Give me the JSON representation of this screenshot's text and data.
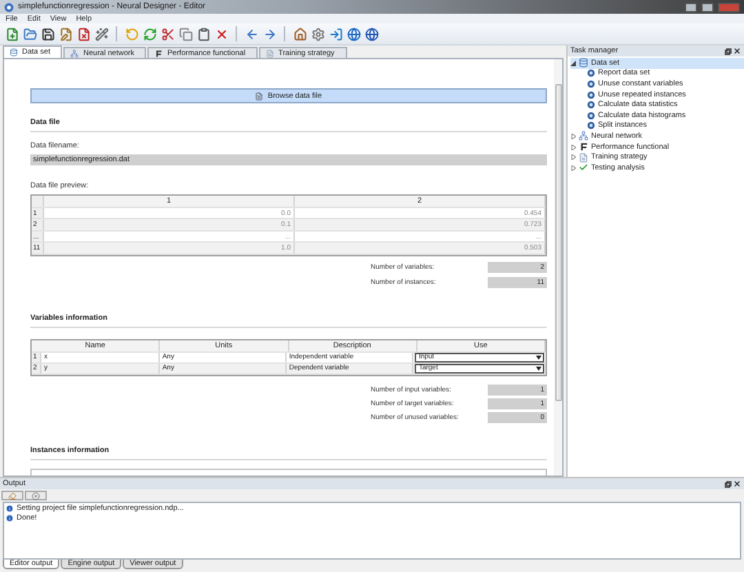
{
  "window": {
    "title": "simplefunctionregression - Neural Designer - Editor"
  },
  "menu": [
    "File",
    "Edit",
    "View",
    "Help"
  ],
  "tabs": [
    {
      "label": "Data set",
      "selected": true,
      "kind": "dataset"
    },
    {
      "label": "Neural network",
      "selected": false,
      "kind": "network"
    },
    {
      "label": "Performance functional",
      "selected": false,
      "kind": "performance"
    },
    {
      "label": "Training strategy",
      "selected": false,
      "kind": "training"
    }
  ],
  "data_set": {
    "browse_button": "Browse data file",
    "data_file": {
      "heading": "Data file",
      "filename_label": "Data filename:",
      "filename": "simplefunctionregression.dat",
      "preview_label": "Data file preview:",
      "preview": {
        "columns": [
          "1",
          "2"
        ],
        "rows": [
          {
            "index": "1",
            "cells": [
              "0.0",
              "0.454"
            ]
          },
          {
            "index": "2",
            "cells": [
              "0.1",
              "0.723"
            ]
          },
          {
            "index": "...",
            "cells": [
              "...",
              "..."
            ]
          },
          {
            "index": "11",
            "cells": [
              "1.0",
              "0.503"
            ]
          }
        ]
      },
      "stats": [
        {
          "label": "Number of variables:",
          "value": "2"
        },
        {
          "label": "Number of instances:",
          "value": "11"
        }
      ]
    },
    "variables": {
      "heading": "Variables information",
      "columns": [
        "Name",
        "Units",
        "Description",
        "Use"
      ],
      "rows": [
        {
          "index": "1",
          "name": "x",
          "units": "Any",
          "description": "Independent variable",
          "use": "Input"
        },
        {
          "index": "2",
          "name": "y",
          "units": "Any",
          "description": "Dependent variable",
          "use": "Target"
        }
      ],
      "stats": [
        {
          "label": "Number of input variables:",
          "value": "1"
        },
        {
          "label": "Number of target variables:",
          "value": "1"
        },
        {
          "label": "Number of unused variables:",
          "value": "0"
        }
      ]
    },
    "instances": {
      "heading": "Instances information"
    }
  },
  "task_manager": {
    "title": "Task manager",
    "items": [
      {
        "label": "Data set",
        "kind": "dataset",
        "expanded": true,
        "selected": true,
        "children": [
          {
            "label": "Report data set"
          },
          {
            "label": "Unuse constant variables"
          },
          {
            "label": "Unuse repeated instances"
          },
          {
            "label": "Calculate data statistics"
          },
          {
            "label": "Calculate data histograms"
          },
          {
            "label": "Split instances"
          }
        ]
      },
      {
        "label": "Neural network",
        "kind": "network",
        "expanded": false,
        "selected": false
      },
      {
        "label": "Performance functional",
        "kind": "performance",
        "expanded": false,
        "selected": false
      },
      {
        "label": "Training strategy",
        "kind": "training",
        "expanded": false,
        "selected": false
      },
      {
        "label": "Testing analysis",
        "kind": "testing",
        "expanded": false,
        "selected": false
      }
    ]
  },
  "output": {
    "title": "Output",
    "messages": [
      "Setting project file simplefunctionregression.ndp...",
      "Done!"
    ],
    "tabs": [
      {
        "label": "Editor output",
        "selected": true
      },
      {
        "label": "Engine output",
        "selected": false
      },
      {
        "label": "Viewer output",
        "selected": false
      }
    ]
  }
}
